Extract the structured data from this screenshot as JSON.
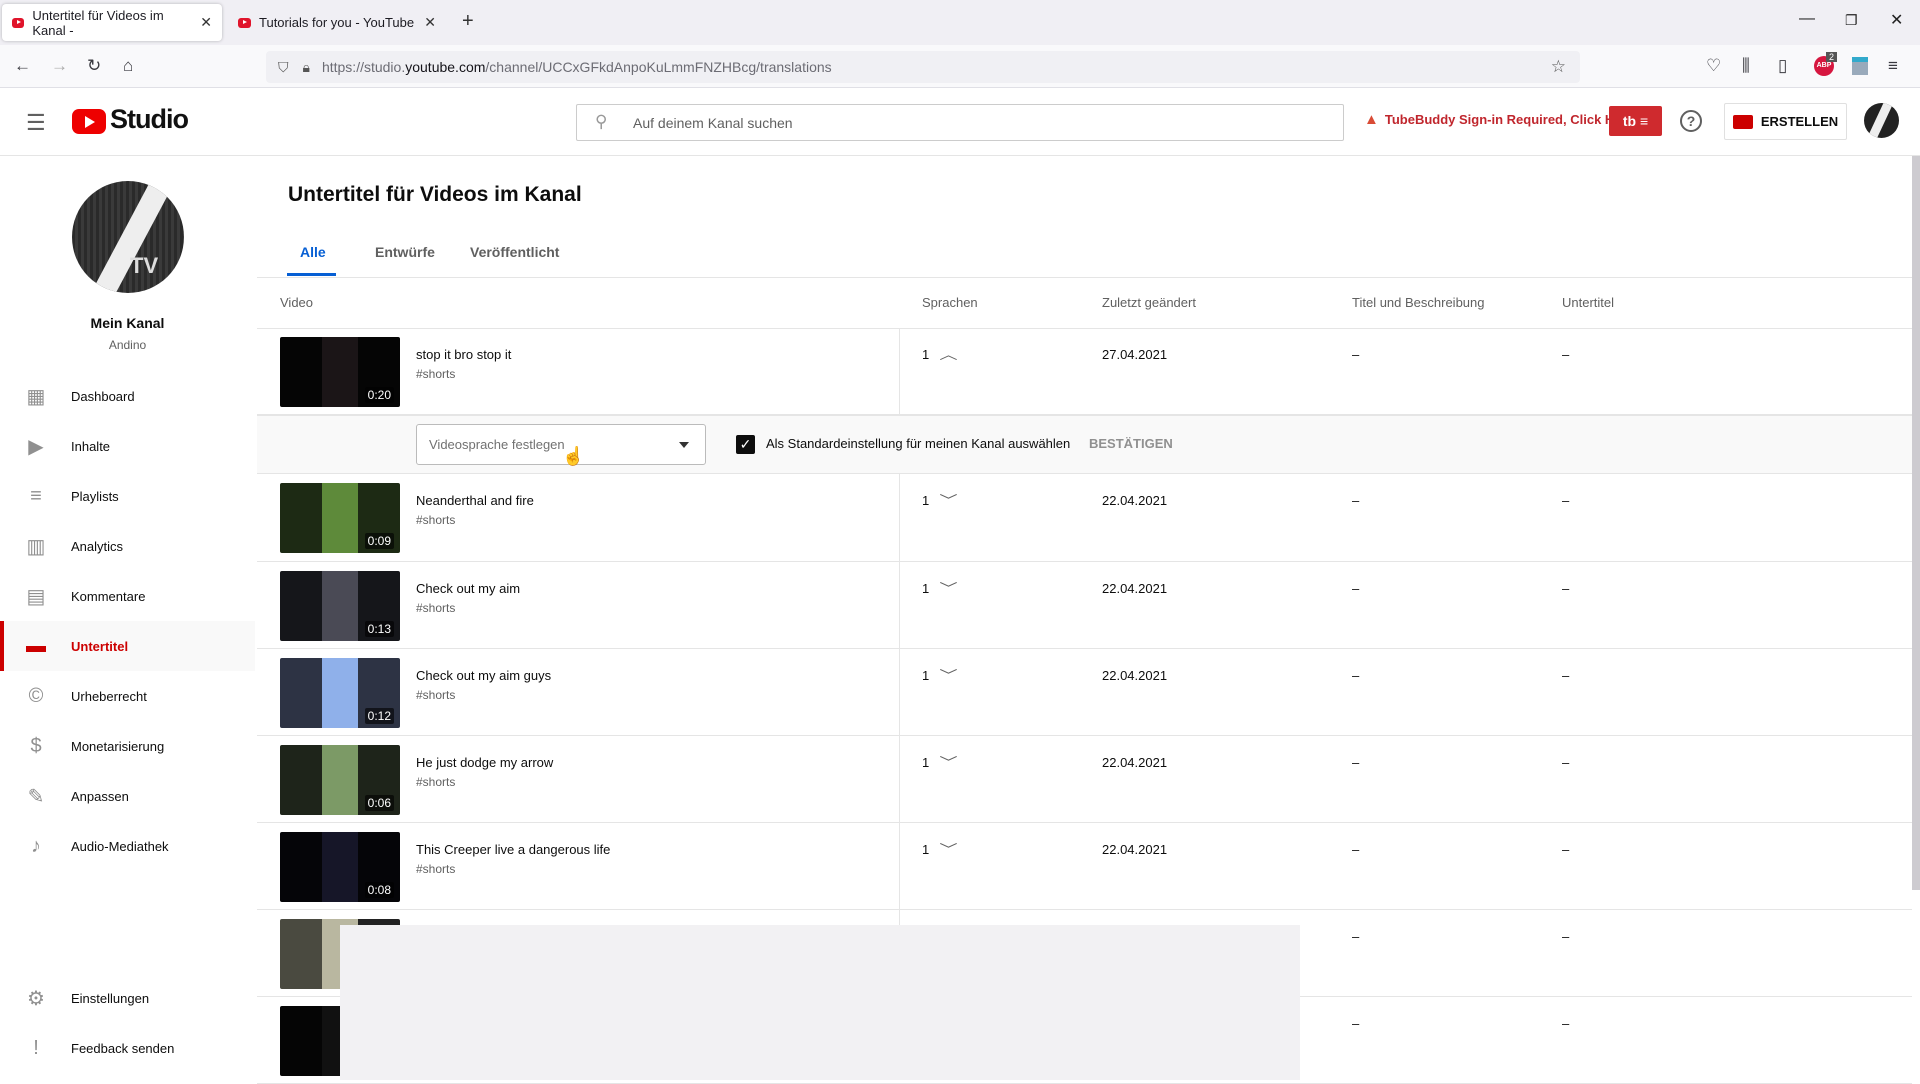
{
  "browser": {
    "tabs": [
      {
        "title": "Untertitel für Videos im Kanal -",
        "active": true
      },
      {
        "title": "Tutorials for you - YouTube",
        "active": false
      }
    ],
    "new_tab": "+",
    "url_prefix": "https://studio.",
    "url_domain": "youtube.com",
    "url_path": "/channel/UCCxGFkdAnpoKuLmmFNZHBcg/translations",
    "abp_badge": "2"
  },
  "header": {
    "logo_text": "Studio",
    "search_placeholder": "Auf deinem Kanal suchen",
    "tubebuddy_warning": "TubeBuddy Sign-in Required, Click Here",
    "tubebuddy_btn": "tb ≡",
    "create_label": "ERSTELLEN"
  },
  "sidebar": {
    "channel_label": "Mein Kanal",
    "channel_name": "Andino",
    "items": [
      {
        "label": "Dashboard",
        "icon": "dashboard-icon"
      },
      {
        "label": "Inhalte",
        "icon": "content-icon"
      },
      {
        "label": "Playlists",
        "icon": "playlist-icon"
      },
      {
        "label": "Analytics",
        "icon": "analytics-icon"
      },
      {
        "label": "Kommentare",
        "icon": "comments-icon"
      },
      {
        "label": "Untertitel",
        "icon": "subtitles-icon",
        "active": true
      },
      {
        "label": "Urheberrecht",
        "icon": "copyright-icon"
      },
      {
        "label": "Monetarisierung",
        "icon": "dollar-icon"
      },
      {
        "label": "Anpassen",
        "icon": "magic-wand-icon"
      },
      {
        "label": "Audio-Mediathek",
        "icon": "audio-library-icon"
      }
    ],
    "bottom_items": [
      {
        "label": "Einstellungen",
        "icon": "gear-icon"
      },
      {
        "label": "Feedback senden",
        "icon": "feedback-icon"
      }
    ]
  },
  "main": {
    "title": "Untertitel für Videos im Kanal",
    "tabs": [
      {
        "label": "Alle",
        "active": true
      },
      {
        "label": "Entwürfe"
      },
      {
        "label": "Veröffentlicht"
      }
    ],
    "columns": [
      "Video",
      "Sprachen",
      "Zuletzt geändert",
      "Titel und Beschreibung",
      "Untertitel"
    ],
    "expanded": {
      "select_placeholder": "Videosprache festlegen",
      "checkbox_label": "Als Standardeinstellung für meinen Kanal auswählen",
      "checkbox_checked": true,
      "confirm_label": "BESTÄTIGEN"
    },
    "rows": [
      {
        "title": "stop it bro stop it",
        "desc": "#shorts",
        "duration": "0:20",
        "langs": "1",
        "date": "27.04.2021",
        "titledesc": "–",
        "subs": "–",
        "expanded": true
      },
      {
        "title": "Neanderthal and fire",
        "desc": "#shorts",
        "duration": "0:09",
        "langs": "1",
        "date": "22.04.2021",
        "titledesc": "–",
        "subs": "–"
      },
      {
        "title": "Check out my aim",
        "desc": "#shorts",
        "duration": "0:13",
        "langs": "1",
        "date": "22.04.2021",
        "titledesc": "–",
        "subs": "–"
      },
      {
        "title": "Check out my aim guys",
        "desc": "#shorts",
        "duration": "0:12",
        "langs": "1",
        "date": "22.04.2021",
        "titledesc": "–",
        "subs": "–"
      },
      {
        "title": "He just dodge my arrow",
        "desc": "#shorts",
        "duration": "0:06",
        "langs": "1",
        "date": "22.04.2021",
        "titledesc": "–",
        "subs": "–"
      },
      {
        "title": "This Creeper live a dangerous life",
        "desc": "#shorts",
        "duration": "0:08",
        "langs": "1",
        "date": "22.04.2021",
        "titledesc": "–",
        "subs": "–"
      },
      {
        "title": "",
        "desc": "",
        "duration": "",
        "langs": "",
        "date": "",
        "titledesc": "–",
        "subs": "–"
      },
      {
        "title": "",
        "desc": "",
        "duration": "",
        "langs": "",
        "date": "",
        "titledesc": "–",
        "subs": "–"
      }
    ]
  }
}
